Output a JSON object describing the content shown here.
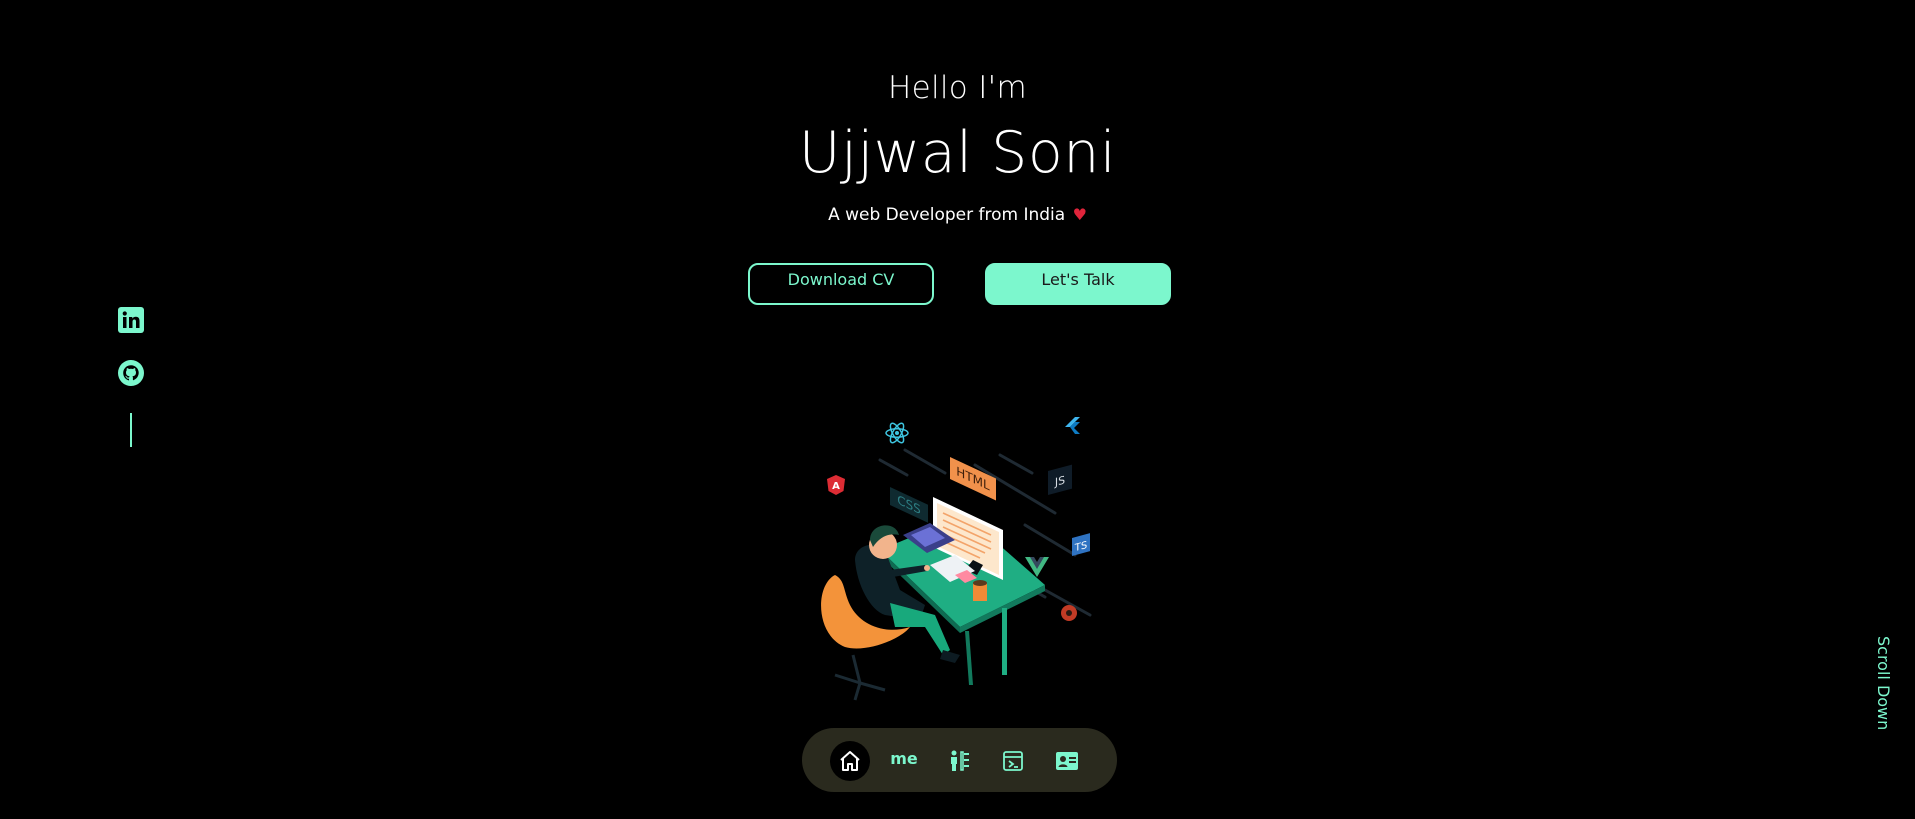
{
  "hero": {
    "greeting": "Hello I'm",
    "name": "Ujjwal Soni",
    "tagline": "A web Developer from India",
    "tagline_emoji": "♥"
  },
  "cta": {
    "download_label": "Download CV",
    "talk_label": "Let's Talk"
  },
  "socials": [
    {
      "name": "linkedin",
      "icon": "linkedin-icon"
    },
    {
      "name": "github",
      "icon": "github-icon"
    }
  ],
  "illustration": {
    "badges": [
      "HTML",
      "CSS",
      "JS",
      "TS",
      "A"
    ]
  },
  "scroll": {
    "label": "Scroll Down"
  },
  "nav": {
    "items": [
      {
        "icon": "home-icon",
        "active": true
      },
      {
        "label": "me"
      },
      {
        "icon": "experience-icon"
      },
      {
        "icon": "projects-icon"
      },
      {
        "icon": "contact-card-icon"
      }
    ]
  },
  "colors": {
    "accent": "#7cf7cd",
    "background": "#000000",
    "nav_bg": "#2a2a1e"
  }
}
